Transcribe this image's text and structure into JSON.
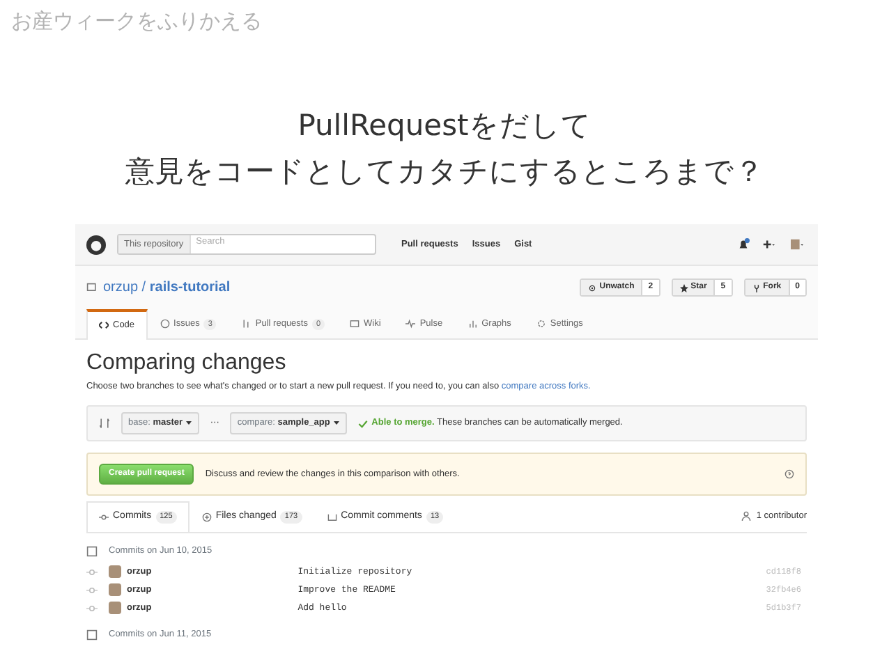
{
  "slide_title": "お産ウィークをふりかえる",
  "heading_lines": [
    "PullRequestをだして",
    "意見をコードとしてカタチにするところまで？"
  ],
  "github": {
    "navbar": {
      "scope_label": "This repository",
      "search_placeholder": "Search",
      "links": [
        "Pull requests",
        "Issues",
        "Gist"
      ]
    },
    "repo": {
      "owner": "orzup",
      "separator": "/",
      "name": "rails-tutorial",
      "actions": [
        {
          "label": "Unwatch",
          "count": "2"
        },
        {
          "label": "Star",
          "count": "5"
        },
        {
          "label": "Fork",
          "count": "0"
        }
      ]
    },
    "tabs": [
      {
        "label": "Code",
        "selected": true
      },
      {
        "label": "Issues",
        "count": "3",
        "selected": false
      },
      {
        "label": "Pull requests",
        "count": "0",
        "selected": false
      },
      {
        "label": "Wiki",
        "selected": false
      },
      {
        "label": "Pulse",
        "selected": false
      },
      {
        "label": "Graphs",
        "selected": false
      },
      {
        "label": "Settings",
        "selected": false
      }
    ],
    "compare": {
      "title": "Comparing changes",
      "description": "Choose two branches to see what's changed or to start a new pull request. If you need to, you can also",
      "link": "compare across forks."
    },
    "range": {
      "base_label": "base:",
      "base_value": "master",
      "dots": "···",
      "compare_label": "compare:",
      "compare_value": "sample_app",
      "merge_status": "Able to merge.",
      "merge_note": "These branches can be automatically merged."
    },
    "pr_box": {
      "button": "Create pull request",
      "text": "Discuss and review the changes in this comparison with others."
    },
    "subtabs": [
      {
        "label": "Commits",
        "count": "125",
        "selected": true
      },
      {
        "label": "Files changed",
        "count": "173",
        "selected": false
      },
      {
        "label": "Commit comments",
        "count": "13",
        "selected": false
      }
    ],
    "contributors": "1 contributor",
    "commit_groups": [
      {
        "date_label": "Commits on Jun 10, 2015",
        "commits": [
          {
            "author": "orzup",
            "message": "Initialize repository",
            "sha": "cd118f8"
          },
          {
            "author": "orzup",
            "message": "Improve the README",
            "sha": "32fb4e6"
          },
          {
            "author": "orzup",
            "message": "Add hello",
            "sha": "5d1b3f7"
          }
        ]
      },
      {
        "date_label": "Commits on Jun 11, 2015"
      }
    ]
  }
}
